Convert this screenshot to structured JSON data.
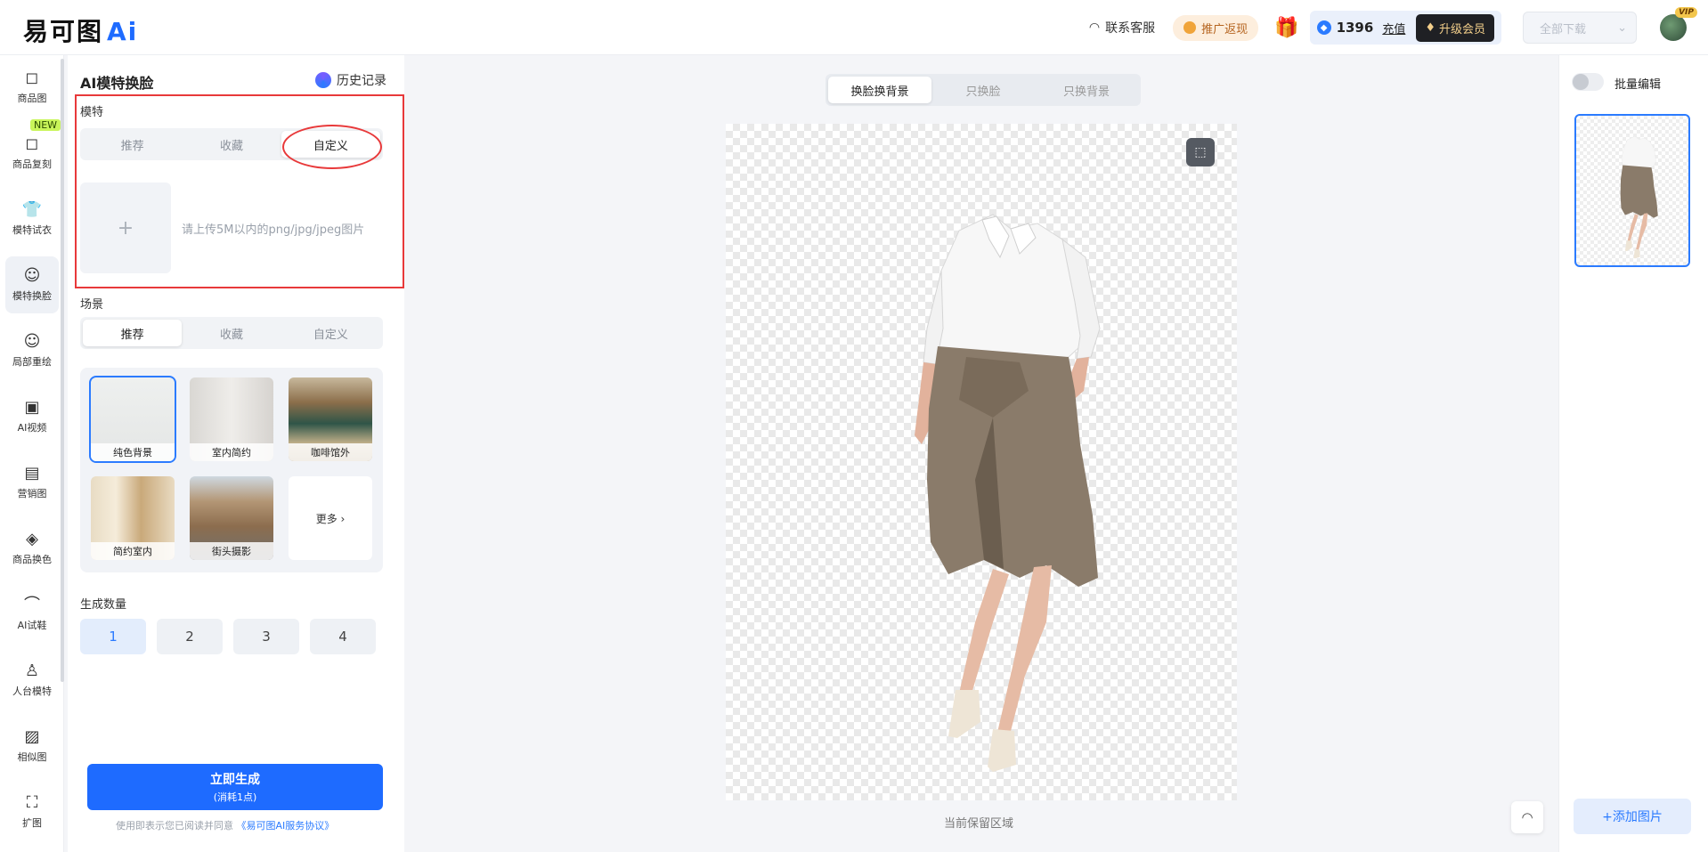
{
  "header": {
    "logo_text": "易可图",
    "logo_ai": "Ai",
    "service": "联系客服",
    "promo": "推广返现",
    "balance": "1396",
    "recharge": "充值",
    "vip_upgrade": "升级会员",
    "download_all": "全部下载",
    "avatar_badge": "VIP"
  },
  "nav": [
    {
      "label": "商品图",
      "icon": "bag-icon"
    },
    {
      "label": "商品复刻",
      "icon": "copy-bag-icon",
      "badge": "NEW"
    },
    {
      "label": "模特试衣",
      "icon": "shirt-icon"
    },
    {
      "label": "模特换脸",
      "icon": "face-icon"
    },
    {
      "label": "局部重绘",
      "icon": "face-edit-icon"
    },
    {
      "label": "AI视频",
      "icon": "video-icon"
    },
    {
      "label": "营销图",
      "icon": "doc-icon"
    },
    {
      "label": "商品换色",
      "icon": "drop-icon"
    },
    {
      "label": "AI试鞋",
      "icon": "shoe-icon"
    },
    {
      "label": "人台模特",
      "icon": "mannequin-icon"
    },
    {
      "label": "相似图",
      "icon": "images-icon"
    },
    {
      "label": "扩图",
      "icon": "expand-icon"
    }
  ],
  "panel": {
    "title": "AI模特换脸",
    "history": "历史记录",
    "model_label": "模特",
    "model_tabs": [
      "推荐",
      "收藏",
      "自定义"
    ],
    "upload_plus": "+",
    "upload_hint": "请上传5M以内的png/jpg/jpeg图片",
    "scene_label": "场景",
    "scene_tabs": [
      "推荐",
      "收藏",
      "自定义"
    ],
    "scenes": [
      "纯色背景",
      "室内简约",
      "咖啡馆外",
      "简约室内",
      "街头摄影"
    ],
    "more": "更多 ›",
    "count_label": "生成数量",
    "counts": [
      "1",
      "2",
      "3",
      "4"
    ],
    "generate": "立即生成",
    "generate_sub": "(消耗1点)",
    "agree_prefix": "使用即表示您已阅读并同意",
    "agree_link": "《易可图AI服务协议》"
  },
  "canvas": {
    "modes": [
      "换脸换背景",
      "只换脸",
      "只换背景"
    ],
    "keep_label": "当前保留区域"
  },
  "right": {
    "batch_label": "批量编辑",
    "add_image": "+添加图片"
  },
  "colors": {
    "accent": "#1e6bff",
    "annotation": "#e8393a"
  }
}
